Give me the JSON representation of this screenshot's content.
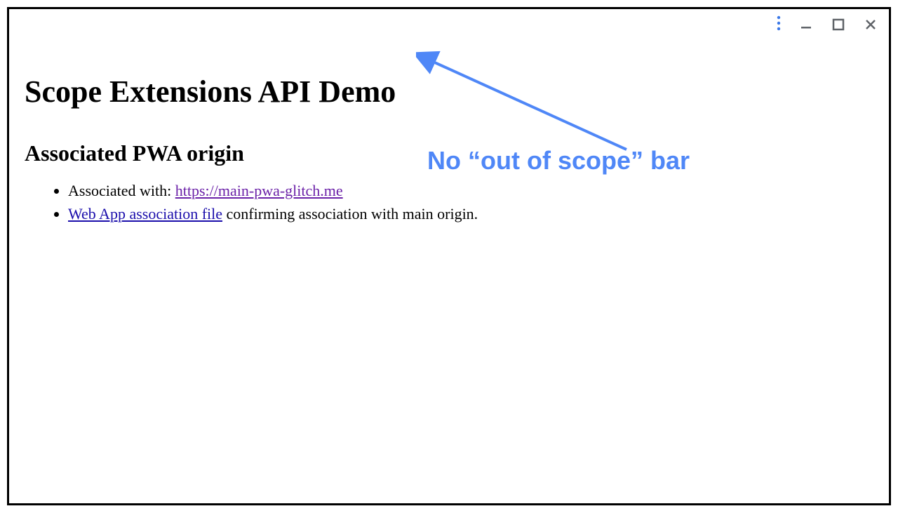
{
  "page": {
    "title": "Scope Extensions API Demo",
    "section_title": "Associated PWA origin",
    "list": [
      {
        "prefix": "Associated with: ",
        "link_text": "https://main-pwa-glitch.me",
        "link_style": "visited",
        "suffix": ""
      },
      {
        "prefix": "",
        "link_text": "Web App association file",
        "link_style": "normal",
        "suffix": " confirming association with main origin."
      }
    ]
  },
  "annotation": {
    "label": "No “out of scope” bar",
    "color": "#4f87f7"
  },
  "window_controls": {
    "menu": "more-vert-icon",
    "minimize": "minimize-icon",
    "maximize": "maximize-icon",
    "close": "close-icon"
  }
}
